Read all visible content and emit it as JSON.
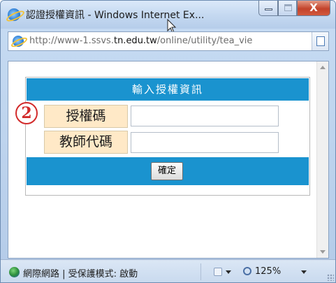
{
  "window": {
    "title": "認證授權資訊 - Windows Internet Ex...",
    "close_glyph": "X"
  },
  "address": {
    "url_prefix": "http://www-1.ssvs.",
    "url_domain": "tn.edu.tw",
    "url_path": "/online/utility/tea_vie"
  },
  "form": {
    "header": "輸入授權資訊",
    "step_badge": "2",
    "code_label": "授權碼",
    "code_value": "",
    "teacher_label": "教師代碼",
    "teacher_value": "",
    "confirm_label": "確定"
  },
  "status": {
    "zone_text": "網際網路 | 受保護模式: 啟動",
    "zoom_text": "125%"
  },
  "colors": {
    "header_blue": "#1a93cf",
    "label_bg": "#ffe9c7",
    "badge_red": "#d22b2b"
  },
  "icons": [
    "ie-logo-icon",
    "cursor-icon",
    "minimize-icon",
    "maximize-icon",
    "close-icon",
    "compatibility-view-icon",
    "globe-icon",
    "addon-icon",
    "zoom-icon"
  ]
}
